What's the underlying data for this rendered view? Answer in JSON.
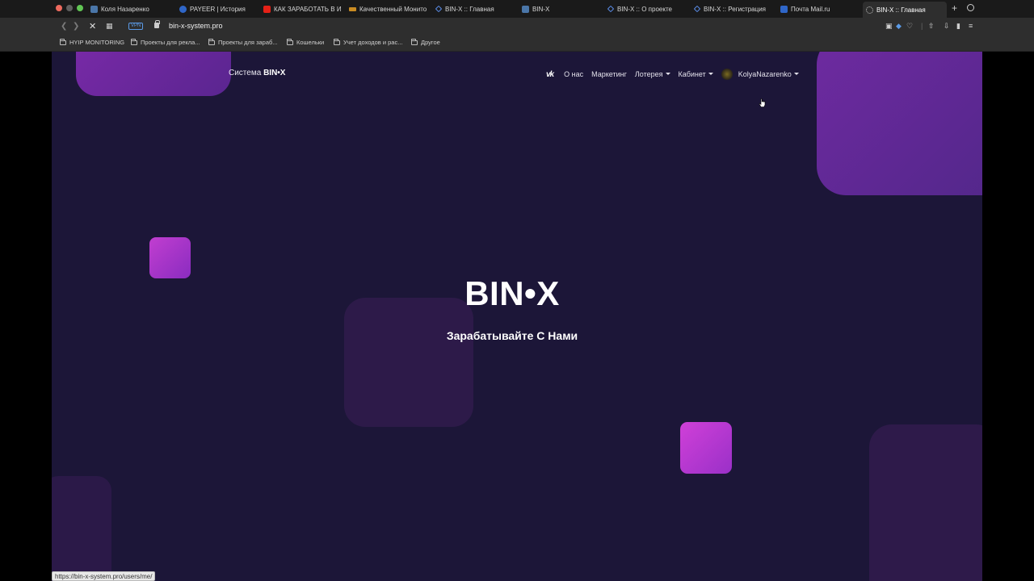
{
  "tabs": [
    {
      "label": "Коля Назаренко",
      "icon": "vk-icon"
    },
    {
      "label": "PAYEER | История",
      "icon": "payeer-icon"
    },
    {
      "label": "КАК ЗАРАБОТАТЬ В ИНТ",
      "icon": "youtube-icon"
    },
    {
      "label": "Качественный Монитор",
      "icon": "monitor-icon"
    },
    {
      "label": "BIN-X :: Главная",
      "icon": "binx-icon"
    },
    {
      "label": "BIN-X",
      "icon": "vk-icon"
    },
    {
      "label": "BIN-X :: О проекте",
      "icon": "binx-icon"
    },
    {
      "label": "BIN-X :: Регистрация",
      "icon": "binx-icon"
    },
    {
      "label": "Почта Mail.ru",
      "icon": "mail-icon"
    },
    {
      "label": "BIN-X :: Главная",
      "icon": "loading-icon",
      "active": true
    }
  ],
  "address": {
    "vpn_label": "VPN",
    "url": "bin-x-system.pro"
  },
  "bookmarks": [
    {
      "label": "HYIP MONITORING"
    },
    {
      "label": "Проекты для рекла..."
    },
    {
      "label": "Проекты для зараб..."
    },
    {
      "label": "Кошельки"
    },
    {
      "label": "Учет доходов и рас..."
    },
    {
      "label": "Другое"
    }
  ],
  "site": {
    "brand_prefix": "Система",
    "brand_name": "BIN•X",
    "nav": {
      "vk_icon_text": "vk",
      "about": "О нас",
      "marketing": "Маркетинг",
      "lottery": "Лотерея",
      "cabinet": "Кабинет",
      "username": "KolyaNazarenko"
    },
    "hero_title": "BIN•X",
    "hero_subtitle": "Зарабатывайте С Нами"
  },
  "status_bar_url": "https://bin-x-system.pro/users/me/",
  "colors": {
    "page_bg": "#1c1638",
    "accent_magenta": "#c13ed0",
    "accent_purple": "#6e2aa0"
  }
}
